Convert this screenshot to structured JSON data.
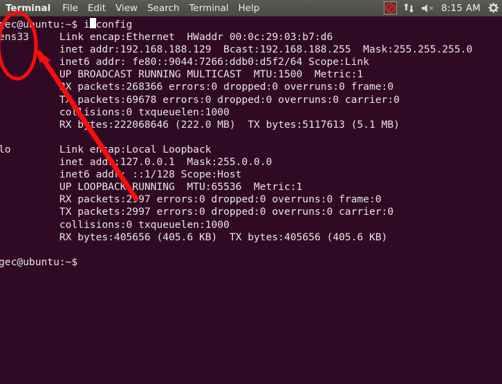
{
  "window": {
    "title": "Terminal",
    "app_name": "Terminal"
  },
  "menubar": {
    "items": [
      {
        "label": "Terminal",
        "name": "menu-app-terminal",
        "bold": true
      },
      {
        "label": "File",
        "name": "menu-file",
        "bold": false
      },
      {
        "label": "Edit",
        "name": "menu-edit",
        "bold": false
      },
      {
        "label": "View",
        "name": "menu-view",
        "bold": false
      },
      {
        "label": "Search",
        "name": "menu-search",
        "bold": false
      },
      {
        "label": "Terminal",
        "name": "menu-terminal",
        "bold": false
      },
      {
        "label": "Help",
        "name": "menu-help",
        "bold": false
      }
    ],
    "tray": {
      "record_blocked_icon": "prohibition-sign-icon",
      "network_icon": "network-up-down-arrows-icon",
      "volume_icon": "speaker-muted-icon",
      "clock": "8:15 AM",
      "settings_icon": "gear-icon"
    }
  },
  "terminal": {
    "prompt": "gec@ubuntu:~$",
    "command": "ifconfig",
    "background_color": "#300a24",
    "text_color": "#e8e6e3",
    "lines": [
      "gec@ubuntu:~$ ifconfig",
      "ens33     Link encap:Ethernet  HWaddr 00:0c:29:03:b7:d6",
      "          inet addr:192.168.188.129  Bcast:192.168.188.255  Mask:255.255.255.0",
      "          inet6 addr: fe80::9044:7266:ddb0:d5f2/64 Scope:Link",
      "          UP BROADCAST RUNNING MULTICAST  MTU:1500  Metric:1",
      "          RX packets:268366 errors:0 dropped:0 overruns:0 frame:0",
      "          TX packets:69678 errors:0 dropped:0 overruns:0 carrier:0",
      "          collisions:0 txqueuelen:1000",
      "          RX bytes:222068646 (222.0 MB)  TX bytes:5117613 (5.1 MB)",
      "",
      "lo        Link encap:Local Loopback",
      "          inet addr:127.0.0.1  Mask:255.0.0.0",
      "          inet6 addr: ::1/128 Scope:Host",
      "          UP LOOPBACK RUNNING  MTU:65536  Metric:1",
      "          RX packets:2997 errors:0 dropped:0 overruns:0 frame:0",
      "          TX packets:2997 errors:0 dropped:0 overruns:0 carrier:0",
      "          collisions:0 txqueuelen:1000",
      "          RX bytes:405656 (405.6 KB)  TX bytes:405656 (405.6 KB)",
      "",
      "gec@ubuntu:~$ "
    ],
    "interfaces": [
      {
        "name": "ens33",
        "link_encap": "Ethernet",
        "hwaddr": "00:0c:29:03:b7:d6",
        "inet_addr": "192.168.188.129",
        "bcast": "192.168.188.255",
        "mask": "255.255.255.0",
        "inet6_addr": "fe80::9044:7266:ddb0:d5f2/64",
        "inet6_scope": "Link",
        "flags": "UP BROADCAST RUNNING MULTICAST",
        "mtu": "1500",
        "metric": "1",
        "rx_packets": "268366",
        "rx_errors": "0",
        "rx_dropped": "0",
        "rx_overruns": "0",
        "rx_frame": "0",
        "tx_packets": "69678",
        "tx_errors": "0",
        "tx_dropped": "0",
        "tx_overruns": "0",
        "tx_carrier": "0",
        "collisions": "0",
        "txqueuelen": "1000",
        "rx_bytes": "222068646",
        "rx_bytes_human": "222.0 MB",
        "tx_bytes": "5117613",
        "tx_bytes_human": "5.1 MB"
      },
      {
        "name": "lo",
        "link_encap": "Local Loopback",
        "inet_addr": "127.0.0.1",
        "mask": "255.0.0.0",
        "inet6_addr": "::1/128",
        "inet6_scope": "Host",
        "flags": "UP LOOPBACK RUNNING",
        "mtu": "65536",
        "metric": "1",
        "rx_packets": "2997",
        "rx_errors": "0",
        "rx_dropped": "0",
        "rx_overruns": "0",
        "rx_frame": "0",
        "tx_packets": "2997",
        "tx_errors": "0",
        "tx_dropped": "0",
        "tx_overruns": "0",
        "tx_carrier": "0",
        "collisions": "0",
        "txqueuelen": "1000",
        "rx_bytes": "405656",
        "rx_bytes_human": "405.6 KB",
        "tx_bytes": "405656",
        "tx_bytes_human": "405.6 KB"
      }
    ]
  },
  "annotation": {
    "color": "#fb0d0d",
    "ellipse_target": "ens33",
    "arrow_description": "arrow pointing to highlighted interface name"
  }
}
